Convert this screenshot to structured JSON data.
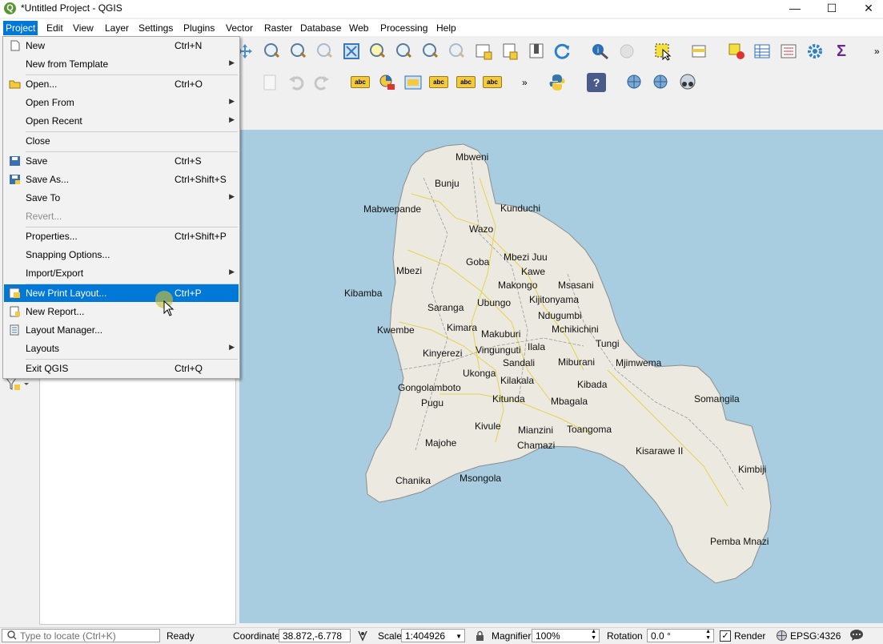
{
  "window": {
    "title": "*Untitled Project - QGIS",
    "logo": "Q",
    "controls": [
      "—",
      "☐",
      "✕"
    ]
  },
  "menubar": [
    "Project",
    "Edit",
    "View",
    "Layer",
    "Settings",
    "Plugins",
    "Vector",
    "Raster",
    "Database",
    "Web",
    "Processing",
    "Help"
  ],
  "project_menu": {
    "items": [
      {
        "label": "New",
        "shortcut": "Ctrl+N",
        "icon": "new-file-icon"
      },
      {
        "label": "New from Template",
        "submenu": true
      },
      {
        "sep": true
      },
      {
        "label": "Open...",
        "shortcut": "Ctrl+O",
        "icon": "folder-open-icon"
      },
      {
        "label": "Open From",
        "submenu": true
      },
      {
        "label": "Open Recent",
        "submenu": true
      },
      {
        "sep": true
      },
      {
        "label": "Close"
      },
      {
        "sep": true
      },
      {
        "label": "Save",
        "shortcut": "Ctrl+S",
        "icon": "save-icon"
      },
      {
        "label": "Save As...",
        "shortcut": "Ctrl+Shift+S",
        "icon": "save-as-icon"
      },
      {
        "label": "Save To",
        "submenu": true
      },
      {
        "label": "Revert...",
        "disabled": true
      },
      {
        "sep": true
      },
      {
        "label": "Properties...",
        "shortcut": "Ctrl+Shift+P"
      },
      {
        "label": "Snapping Options..."
      },
      {
        "label": "Import/Export",
        "submenu": true
      },
      {
        "sep": true
      },
      {
        "label": "New Print Layout...",
        "shortcut": "Ctrl+P",
        "icon": "print-layout-icon",
        "highlighted": true
      },
      {
        "label": "New Report...",
        "icon": "report-icon"
      },
      {
        "label": "Layout Manager...",
        "icon": "layout-manager-icon"
      },
      {
        "label": "Layouts",
        "submenu": true
      },
      {
        "sep": true
      },
      {
        "label": "Exit QGIS",
        "shortcut": "Ctrl+Q"
      }
    ]
  },
  "toolbar": {
    "overflow": "»",
    "label_icons": [
      "abc",
      "abc",
      "abc",
      "abc"
    ],
    "help": "?"
  },
  "map": {
    "water_color": "#a8cce0",
    "land_color": "#ece9e0",
    "places": [
      "Mbweni",
      "Bunju",
      "Mabwepande",
      "Kunduchi",
      "Wazo",
      "Goba",
      "Mbezi Juu",
      "Mbezi",
      "Kawe",
      "Makongo",
      "Msasani",
      "Kibamba",
      "Ubungo",
      "Kijitonyama",
      "Saranga",
      "Ndugumbi",
      "Kimara",
      "Mchikichini",
      "Kwembe",
      "Makuburi",
      "Tungi",
      "Vingunguti",
      "Ilala",
      "Kinyerezi",
      "Sandali",
      "Miburani",
      "Mjimwema",
      "Ukonga",
      "Kilakala",
      "Kibada",
      "Gongolamboto",
      "Kitunda",
      "Mbagala",
      "Somangila",
      "Pugu",
      "Kivule",
      "Mianzini",
      "Toangoma",
      "Majohe",
      "Chamazi",
      "Kisarawe II",
      "Kimbiji",
      "Chanika",
      "Msongola",
      "Pemba Mnazi"
    ]
  },
  "statusbar": {
    "locate_placeholder": "Type to locate (Ctrl+K)",
    "ready": "Ready",
    "coordinate_label": "Coordinate",
    "coordinate_value": "38.872,-6.778",
    "scale_label": "Scale",
    "scale_value": "1:404926",
    "magnifier_label": "Magnifier",
    "magnifier_value": "100%",
    "rotation_label": "Rotation",
    "rotation_value": "0.0 °",
    "render_label": "Render",
    "render_checked": true,
    "crs": "EPSG:4326"
  }
}
